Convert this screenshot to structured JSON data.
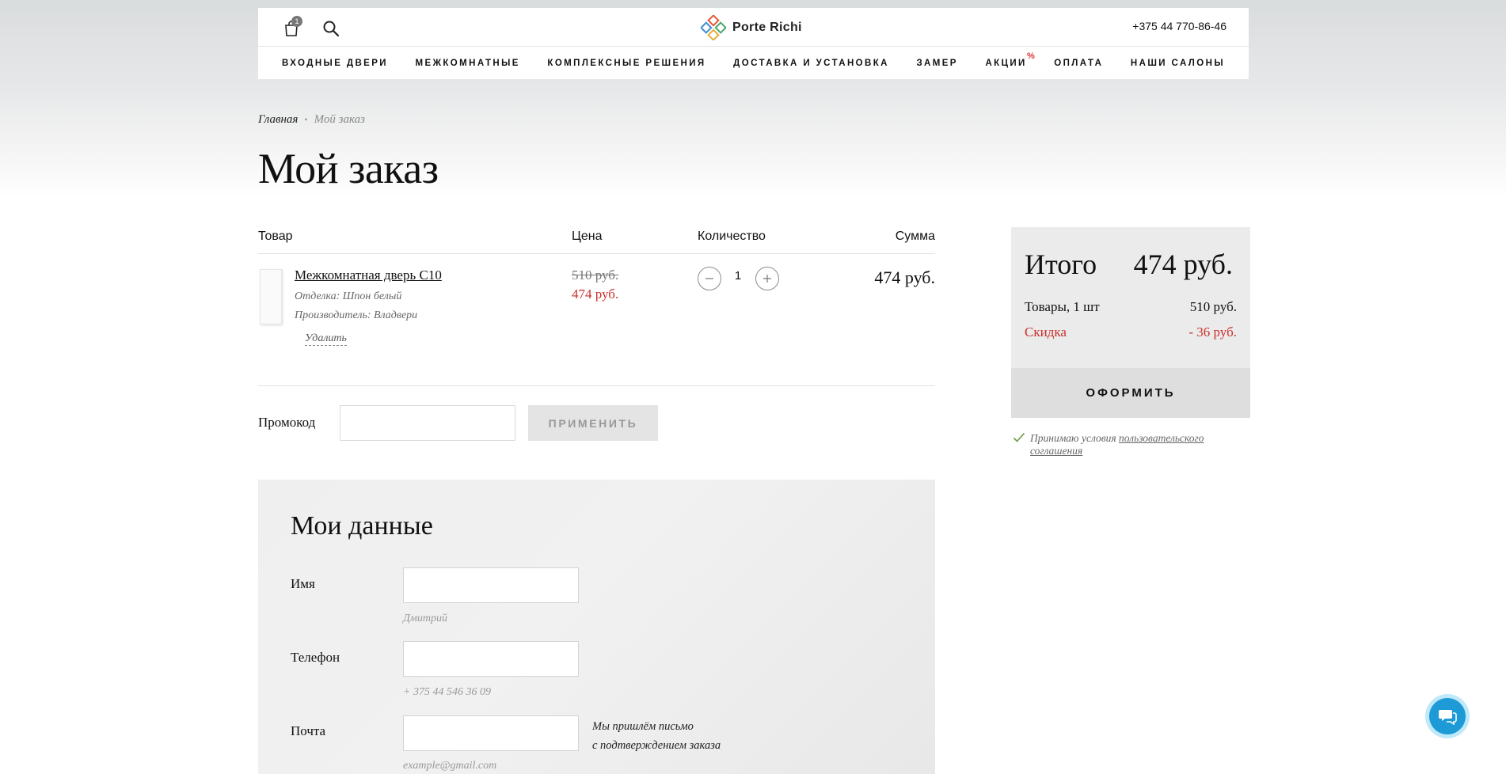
{
  "header": {
    "cart_count": "1",
    "logo_text": "Porte Richi",
    "phone": "+375 44 770-86-46",
    "nav": [
      {
        "label": "ВХОДНЫЕ ДВЕРИ"
      },
      {
        "label": "МЕЖКОМНАТНЫЕ"
      },
      {
        "label": "КОМПЛЕКСНЫЕ РЕШЕНИЯ"
      },
      {
        "label": "ДОСТАВКА И УСТАНОВКА"
      },
      {
        "label": "ЗАМЕР"
      },
      {
        "label": "АКЦИИ",
        "badge": "%"
      },
      {
        "label": "ОПЛАТА"
      },
      {
        "label": "НАШИ САЛОНЫ"
      }
    ]
  },
  "breadcrumb": {
    "home": "Главная",
    "separator": "•",
    "current": "Мой заказ"
  },
  "page_title": "Мой заказ",
  "table": {
    "headers": {
      "product": "Товар",
      "price": "Цена",
      "quantity": "Количество",
      "sum": "Сумма"
    },
    "items": [
      {
        "name": "Межкомнатная дверь С10",
        "finish": "Отделка: Шпон белый",
        "maker": "Производитель: Владвери",
        "remove": "Удалить",
        "old_price": "510 руб.",
        "new_price": "474 руб.",
        "quantity": "1",
        "sum": "474 руб."
      }
    ]
  },
  "promo": {
    "label": "Промокод",
    "value": "",
    "button": "ПРИМЕНИТЬ"
  },
  "my_data": {
    "title": "Мои данные",
    "fields": [
      {
        "label": "Имя",
        "value": "",
        "hint": "Дмитрий"
      },
      {
        "label": "Телефон",
        "value": "",
        "hint": "+ 375 44 546 36 09"
      },
      {
        "label": "Почта",
        "value": "",
        "hint": "example@gmail.com"
      }
    ],
    "email_note_line1": "Мы пришлём письмо",
    "email_note_line2": "с подтверждением заказа"
  },
  "summary": {
    "label": "Итого",
    "total": "474 руб.",
    "goods_label": "Товары, 1 шт",
    "goods_value": "510 руб.",
    "discount_label": "Скидка",
    "discount_value": "- 36 руб.",
    "checkout": "ОФОРМИТЬ",
    "agree_text": "Принимаю условия ",
    "agree_link": "пользовательского соглашения",
    "agree_checked": true
  },
  "colors": {
    "accent_red": "#c9302c",
    "chat_blue": "#1e9ad6"
  }
}
